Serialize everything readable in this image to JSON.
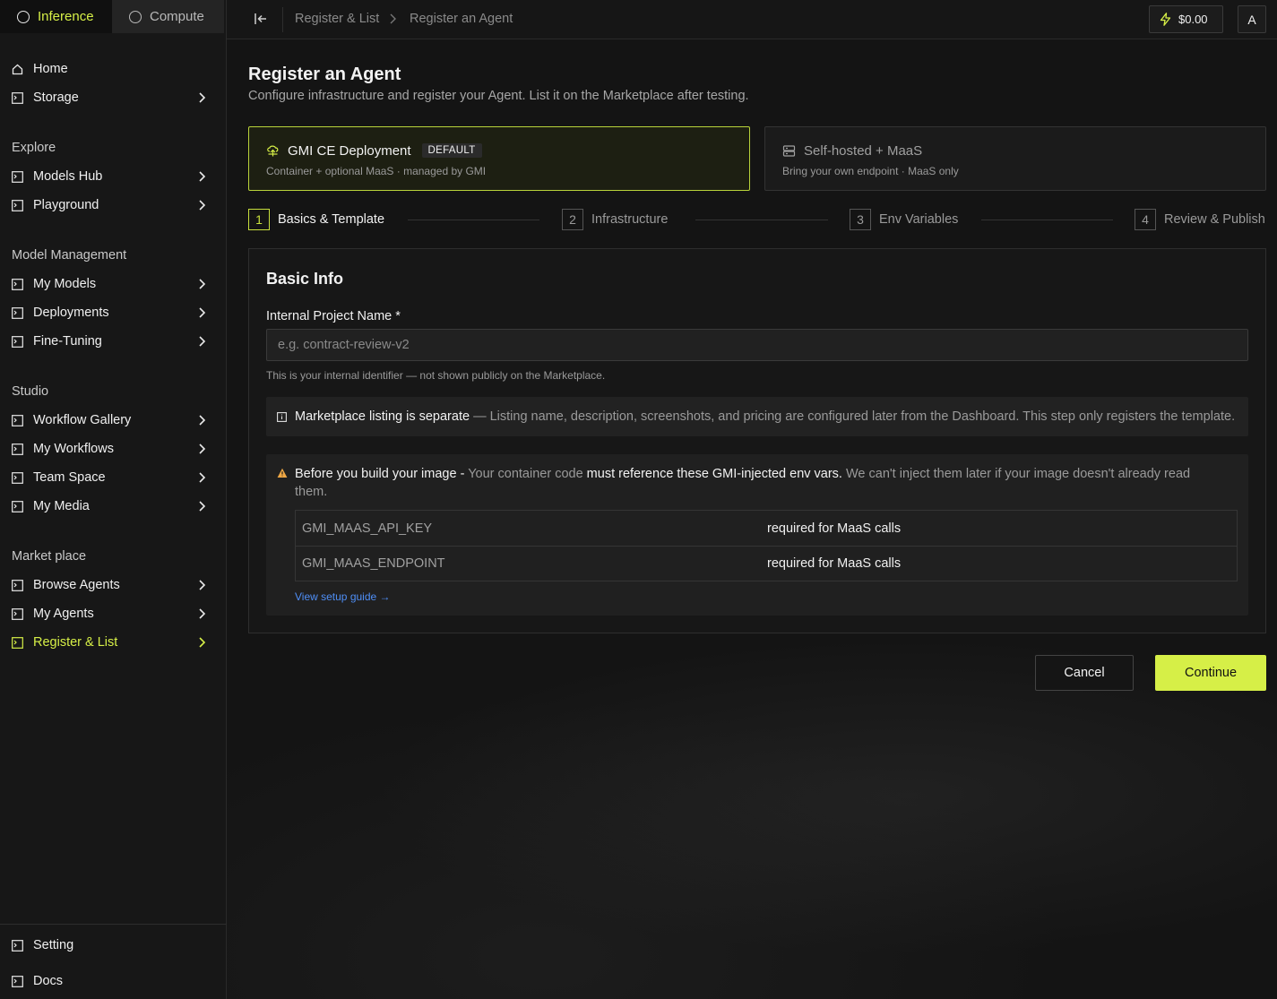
{
  "sidebar": {
    "tabs": [
      {
        "label": "Inference"
      },
      {
        "label": "Compute"
      }
    ],
    "items": [
      {
        "label": "Home"
      },
      {
        "label": "Storage"
      },
      {
        "label": "Models Hub"
      },
      {
        "label": "Playground"
      },
      {
        "label": "My Models"
      },
      {
        "label": "Deployments"
      },
      {
        "label": "Fine-Tuning"
      },
      {
        "label": "Workflow Gallery"
      },
      {
        "label": "My Workflows"
      },
      {
        "label": "Team Space"
      },
      {
        "label": "My Media"
      },
      {
        "label": "Browse Agents"
      },
      {
        "label": "My Agents"
      },
      {
        "label": "Register & List"
      },
      {
        "label": "Setting"
      },
      {
        "label": "Docs"
      }
    ],
    "sections": {
      "explore": "Explore",
      "model_management": "Model Management",
      "studio": "Studio",
      "marketplace": "Market place"
    }
  },
  "topbar": {
    "breadcrumb": [
      "Register & List",
      "Register an Agent"
    ],
    "balance": "$0.00",
    "avatar": "A"
  },
  "page": {
    "title": "Register an Agent",
    "subtitle": "Configure infrastructure and register your Agent. List it on the Marketplace after testing."
  },
  "options": [
    {
      "title": "GMI CE Deployment",
      "badge": "DEFAULT",
      "desc": "Container + optional MaaS · managed by GMI"
    },
    {
      "title": "Self-hosted + MaaS",
      "desc": "Bring your own endpoint · MaaS only"
    }
  ],
  "steps": [
    {
      "num": "1",
      "label": "Basics & Template"
    },
    {
      "num": "2",
      "label": "Infrastructure"
    },
    {
      "num": "3",
      "label": "Env Variables"
    },
    {
      "num": "4",
      "label": "Review & Publish"
    }
  ],
  "form": {
    "section_title": "Basic Info",
    "project_label": "Internal Project Name *",
    "project_placeholder": "e.g. contract-review-v2",
    "project_help": "This is your internal identifier — not shown publicly on the Marketplace.",
    "info_strong": "Marketplace listing is separate",
    "info_rest": " — Listing name, description, screenshots, and pricing are configured later from the Dashboard. This step only registers the template.",
    "warn_part1": "Before you build your image - ",
    "warn_part2": "Your container code ",
    "warn_part3": "must reference these GMI-injected env vars.",
    "warn_part4": " We can't inject them later if your image doesn't already read them.",
    "env_vars": [
      {
        "key": "GMI_MAAS_API_KEY",
        "note": "required for MaaS calls"
      },
      {
        "key": "GMI_MAAS_ENDPOINT",
        "note": "required for MaaS calls"
      }
    ],
    "setup_link": "View setup guide →"
  },
  "actions": {
    "cancel": "Cancel",
    "continue": "Continue"
  },
  "colors": {
    "accent": "#d6ef47",
    "link": "#4f8ff7",
    "warning": "#f0a845"
  }
}
